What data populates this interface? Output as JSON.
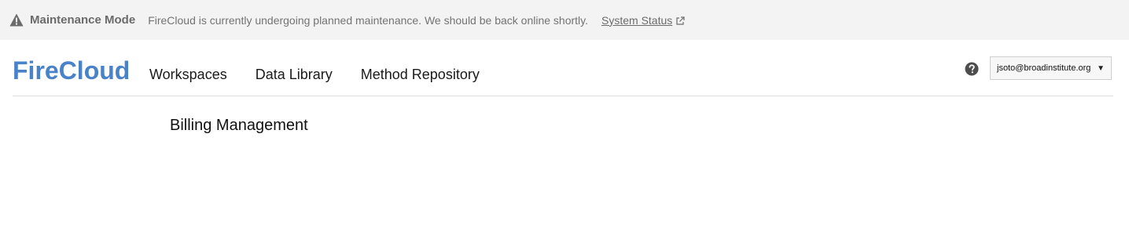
{
  "banner": {
    "title": "Maintenance Mode",
    "message": "FireCloud is currently undergoing planned maintenance. We should be back online shortly.",
    "status_link": "System Status",
    "icons": {
      "warning": "warning-triangle-icon",
      "external": "external-link-icon"
    }
  },
  "header": {
    "logo": "FireCloud",
    "nav": [
      {
        "label": "Workspaces"
      },
      {
        "label": "Data Library"
      },
      {
        "label": "Method Repository"
      }
    ],
    "help_icon": "question-circle-icon",
    "account": {
      "email": "jsoto@broadinstitute.org",
      "caret": "▼"
    }
  },
  "main": {
    "title": "Billing Management"
  },
  "colors": {
    "brand": "#4a82c9",
    "banner_bg": "#f3f3f3",
    "banner_text": "#737373"
  }
}
